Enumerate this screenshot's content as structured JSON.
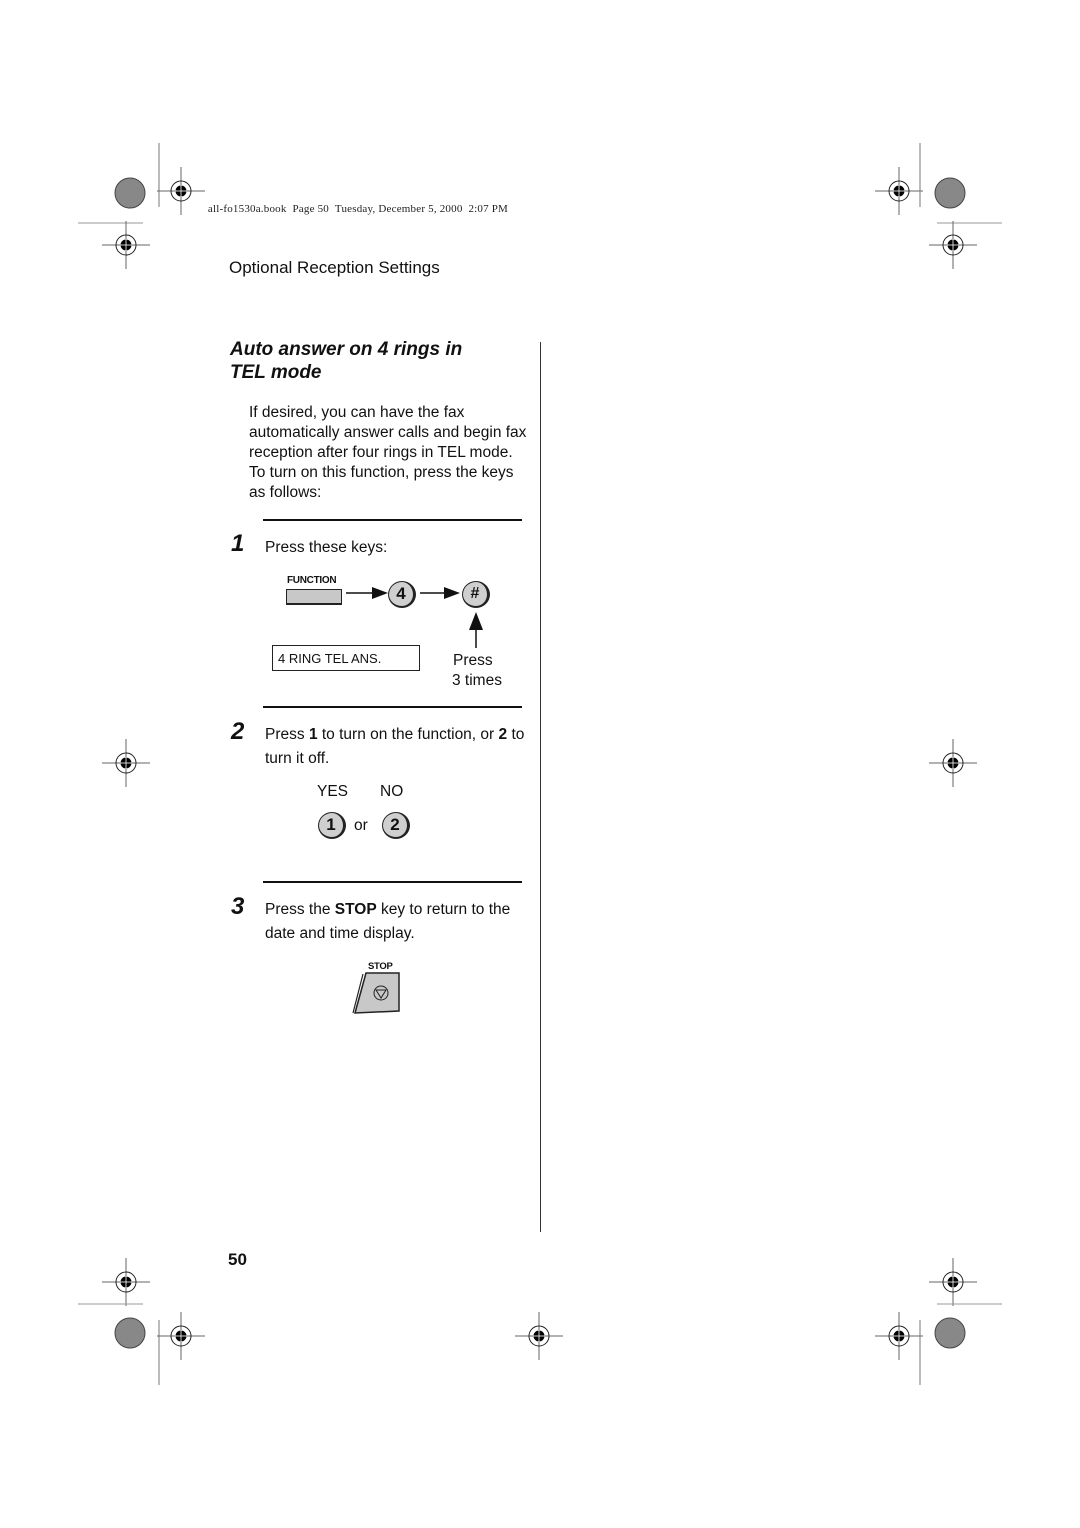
{
  "slug": {
    "file": "all-fo1530a.book",
    "page": "Page 50",
    "date": "Tuesday, December 5, 2000",
    "time": "2:07 PM"
  },
  "header": "Optional Reception Settings",
  "section": {
    "title_line1": "Auto answer on 4 rings in",
    "title_line2": "TEL mode",
    "intro": "If desired, you can have the fax automatically answer calls and begin fax reception after four rings in TEL mode. To turn on this function, press the keys as follows:"
  },
  "steps": [
    {
      "number": "1",
      "text": "Press these keys:",
      "keys": {
        "function_label": "FUNCTION",
        "key_4": "4",
        "key_hash": "#",
        "display": "4 RING TEL ANS.",
        "press_note_line1": "Press",
        "press_note_line2": "3 times"
      }
    },
    {
      "number": "2",
      "text_parts": [
        "Press ",
        "1",
        " to turn on the function, or ",
        "2",
        " to turn it off."
      ],
      "yes_label": "YES",
      "no_label": "NO",
      "key_1": "1",
      "or_label": "or",
      "key_2": "2"
    },
    {
      "number": "3",
      "text_parts": [
        "Press the ",
        "STOP",
        " key to return to the date and time display."
      ],
      "stop_label": "STOP"
    }
  ],
  "page_number": "50"
}
